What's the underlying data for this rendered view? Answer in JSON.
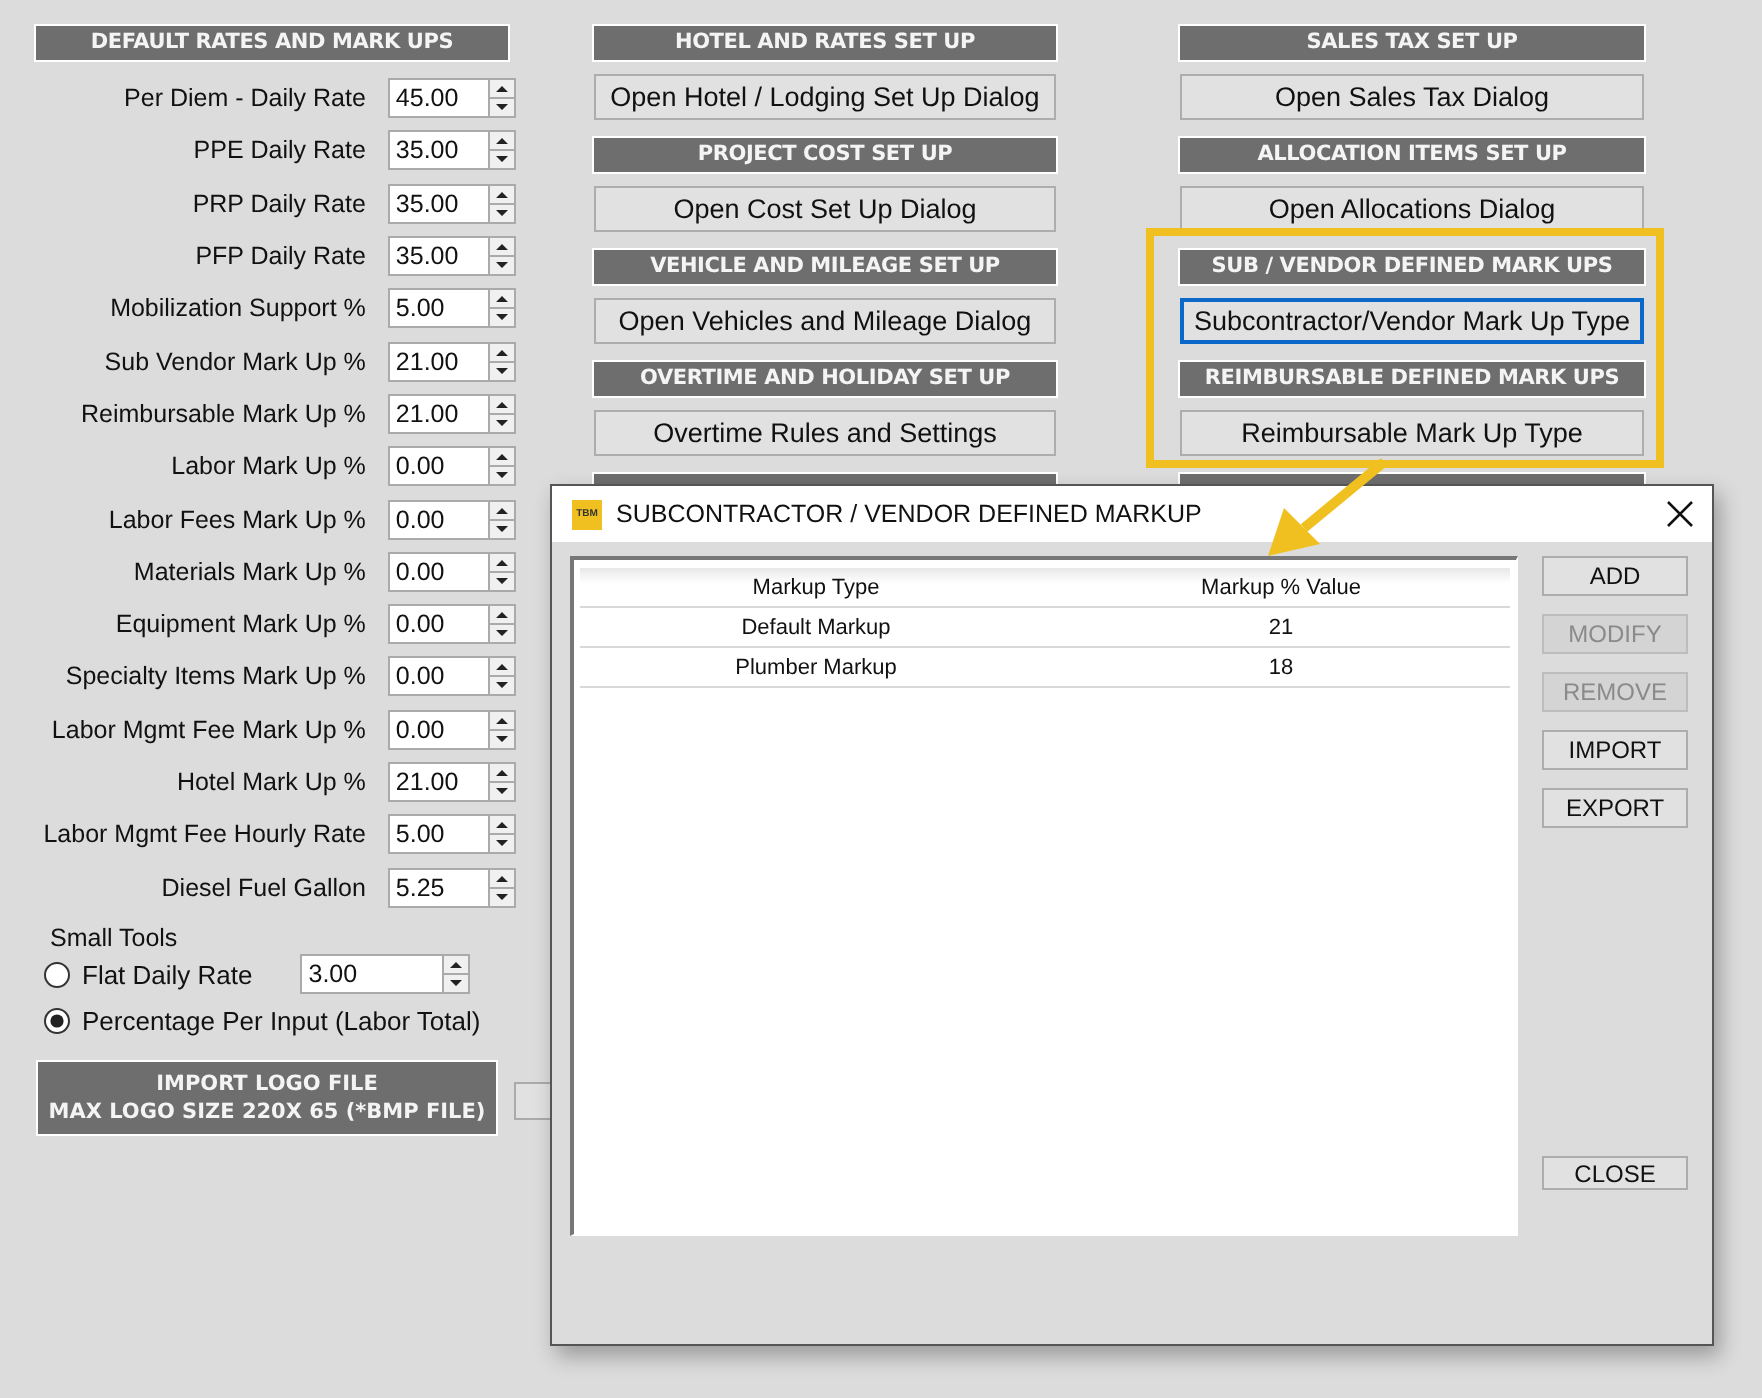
{
  "rates_panel": {
    "header": "DEFAULT RATES AND MARK UPS",
    "fields": [
      {
        "label": "Per Diem - Daily Rate",
        "value": "45.00"
      },
      {
        "label": "PPE Daily Rate",
        "value": "35.00"
      },
      {
        "label": "PRP Daily Rate",
        "value": "35.00"
      },
      {
        "label": "PFP Daily Rate",
        "value": "35.00"
      },
      {
        "label": "Mobilization Support %",
        "value": "5.00"
      },
      {
        "label": "Sub Vendor Mark Up %",
        "value": "21.00"
      },
      {
        "label": "Reimbursable Mark Up %",
        "value": "21.00"
      },
      {
        "label": "Labor Mark Up  %",
        "value": "0.00"
      },
      {
        "label": "Labor Fees Mark Up  %",
        "value": "0.00"
      },
      {
        "label": "Materials Mark Up  %",
        "value": "0.00"
      },
      {
        "label": "Equipment Mark Up  %",
        "value": "0.00"
      },
      {
        "label": "Specialty Items Mark Up  %",
        "value": "0.00"
      },
      {
        "label": "Labor Mgmt Fee Mark Up  %",
        "value": "0.00"
      },
      {
        "label": "Hotel Mark Up  %",
        "value": "21.00"
      },
      {
        "label": "Labor Mgmt Fee Hourly Rate",
        "value": "5.00"
      },
      {
        "label": "Diesel Fuel Gallon",
        "value": "5.25"
      }
    ],
    "small_tools": {
      "label": "Small Tools",
      "options": [
        {
          "label": "Flat Daily Rate",
          "selected": false,
          "value": "3.00"
        },
        {
          "label": "Percentage Per Input (Labor Total)",
          "selected": true
        }
      ]
    },
    "import_button": "IMPORT LOGO FILE\nMAX LOGO SIZE 220X 65 (*BMP FILE)"
  },
  "middle_sections": [
    {
      "header": "HOTEL AND RATES SET UP",
      "button": "Open Hotel / Lodging Set Up Dialog",
      "focused": false
    },
    {
      "header": "PROJECT COST SET UP",
      "button": "Open Cost Set Up Dialog",
      "focused": false
    },
    {
      "header": "VEHICLE AND MILEAGE SET UP",
      "button": "Open Vehicles and Mileage Dialog",
      "focused": false
    },
    {
      "header": "OVERTIME AND HOLIDAY SET UP",
      "button": "Overtime Rules and Settings",
      "focused": false
    }
  ],
  "right_sections": [
    {
      "header": "SALES TAX SET UP",
      "button": "Open Sales Tax Dialog",
      "focused": false
    },
    {
      "header": "ALLOCATION ITEMS SET UP",
      "button": "Open Allocations Dialog",
      "focused": false
    },
    {
      "header": "SUB / VENDOR DEFINED MARK UPS",
      "button": "Subcontractor/Vendor Mark Up Type",
      "focused": true
    },
    {
      "header": "REIMBURSABLE DEFINED MARK UPS",
      "button": "Reimbursable Mark Up Type",
      "focused": false
    }
  ],
  "dialog": {
    "title": "SUBCONTRACTOR / VENDOR DEFINED MARKUP",
    "logo": "TBM",
    "columns": [
      "Markup Type",
      "Markup % Value"
    ],
    "rows": [
      [
        "Default Markup",
        "21"
      ],
      [
        "Plumber Markup",
        "18"
      ]
    ],
    "buttons": [
      {
        "label": "ADD",
        "disabled": false
      },
      {
        "label": "MODIFY",
        "disabled": true
      },
      {
        "label": "REMOVE",
        "disabled": true
      },
      {
        "label": "IMPORT",
        "disabled": false
      },
      {
        "label": "EXPORT",
        "disabled": false
      }
    ],
    "close_button": "CLOSE"
  }
}
